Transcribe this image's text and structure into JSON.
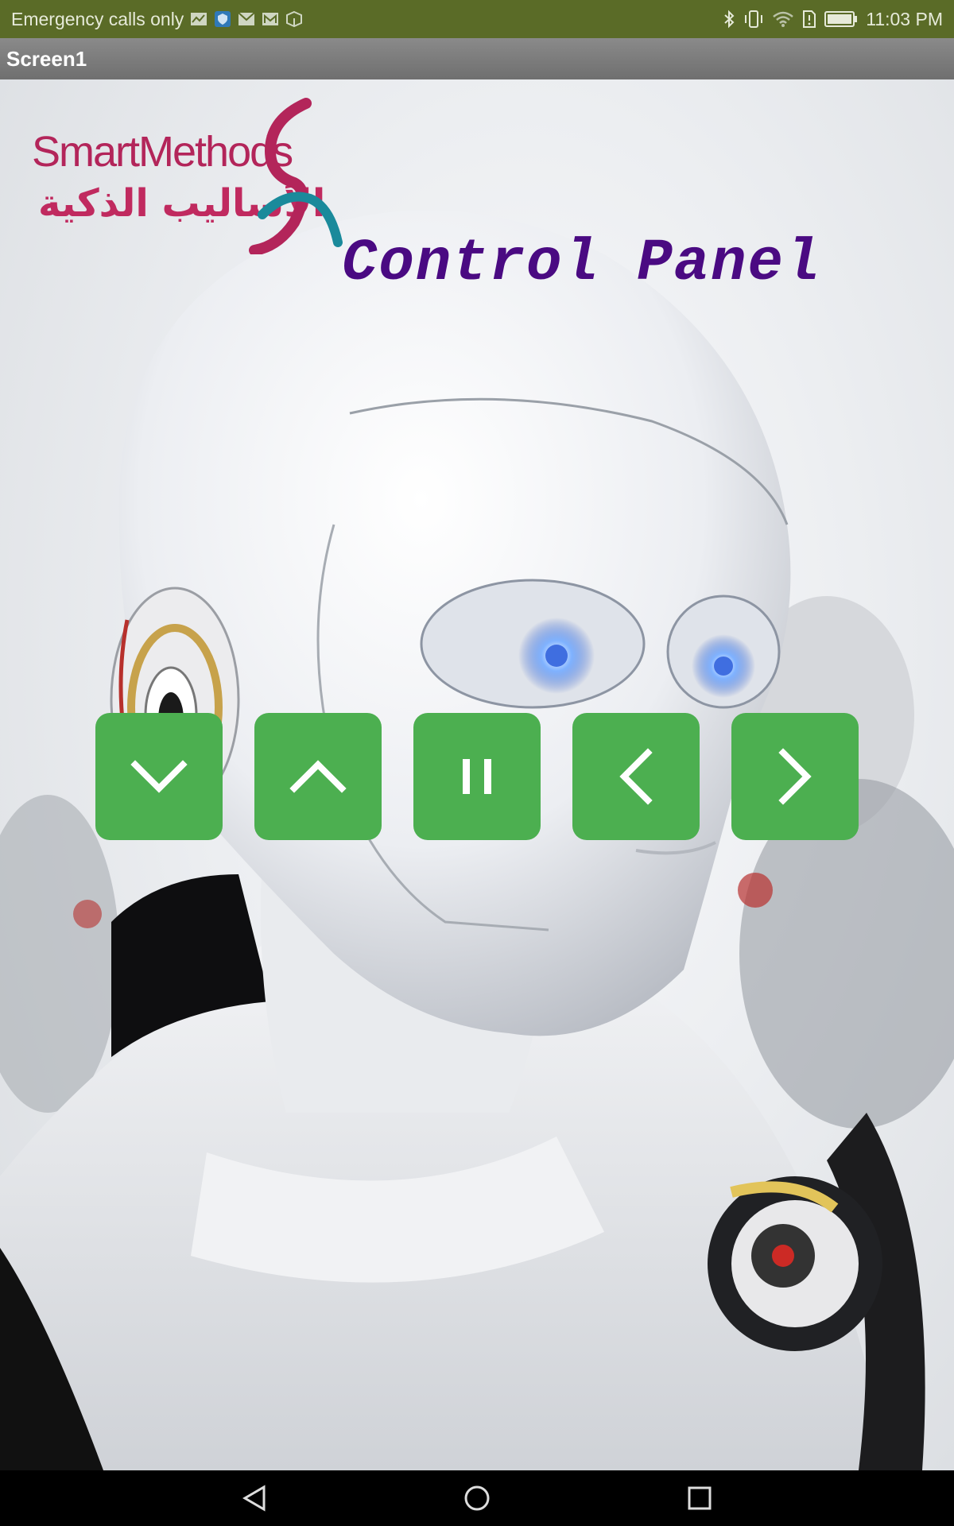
{
  "status_bar": {
    "carrier_text": "Emergency calls only",
    "time": "11:03 PM",
    "left_icons": [
      "activity-icon",
      "shield-icon",
      "mail-icon",
      "gmail-icon",
      "box-icon"
    ],
    "right_icons": [
      "bluetooth-icon",
      "vibrate-icon",
      "wifi-icon",
      "sim-alert-icon",
      "battery-icon"
    ],
    "color": "#5a6b27"
  },
  "title_bar": {
    "title": "Screen1"
  },
  "logo": {
    "english": "SmartMethods",
    "arabic": "الأساليب الذكية"
  },
  "panel_title": "Control Panel",
  "controls": [
    {
      "action": "down",
      "icon": "chevron-down-icon"
    },
    {
      "action": "up",
      "icon": "chevron-up-icon"
    },
    {
      "action": "pause",
      "icon": "pause-icon"
    },
    {
      "action": "left",
      "icon": "chevron-left-icon"
    },
    {
      "action": "right",
      "icon": "chevron-right-icon"
    }
  ],
  "nav_bar": {
    "icons": [
      "back-icon",
      "home-icon",
      "recents-icon"
    ]
  },
  "colors": {
    "button": "#4caf50",
    "title": "#4a0a82",
    "logo": "#b3255a"
  }
}
